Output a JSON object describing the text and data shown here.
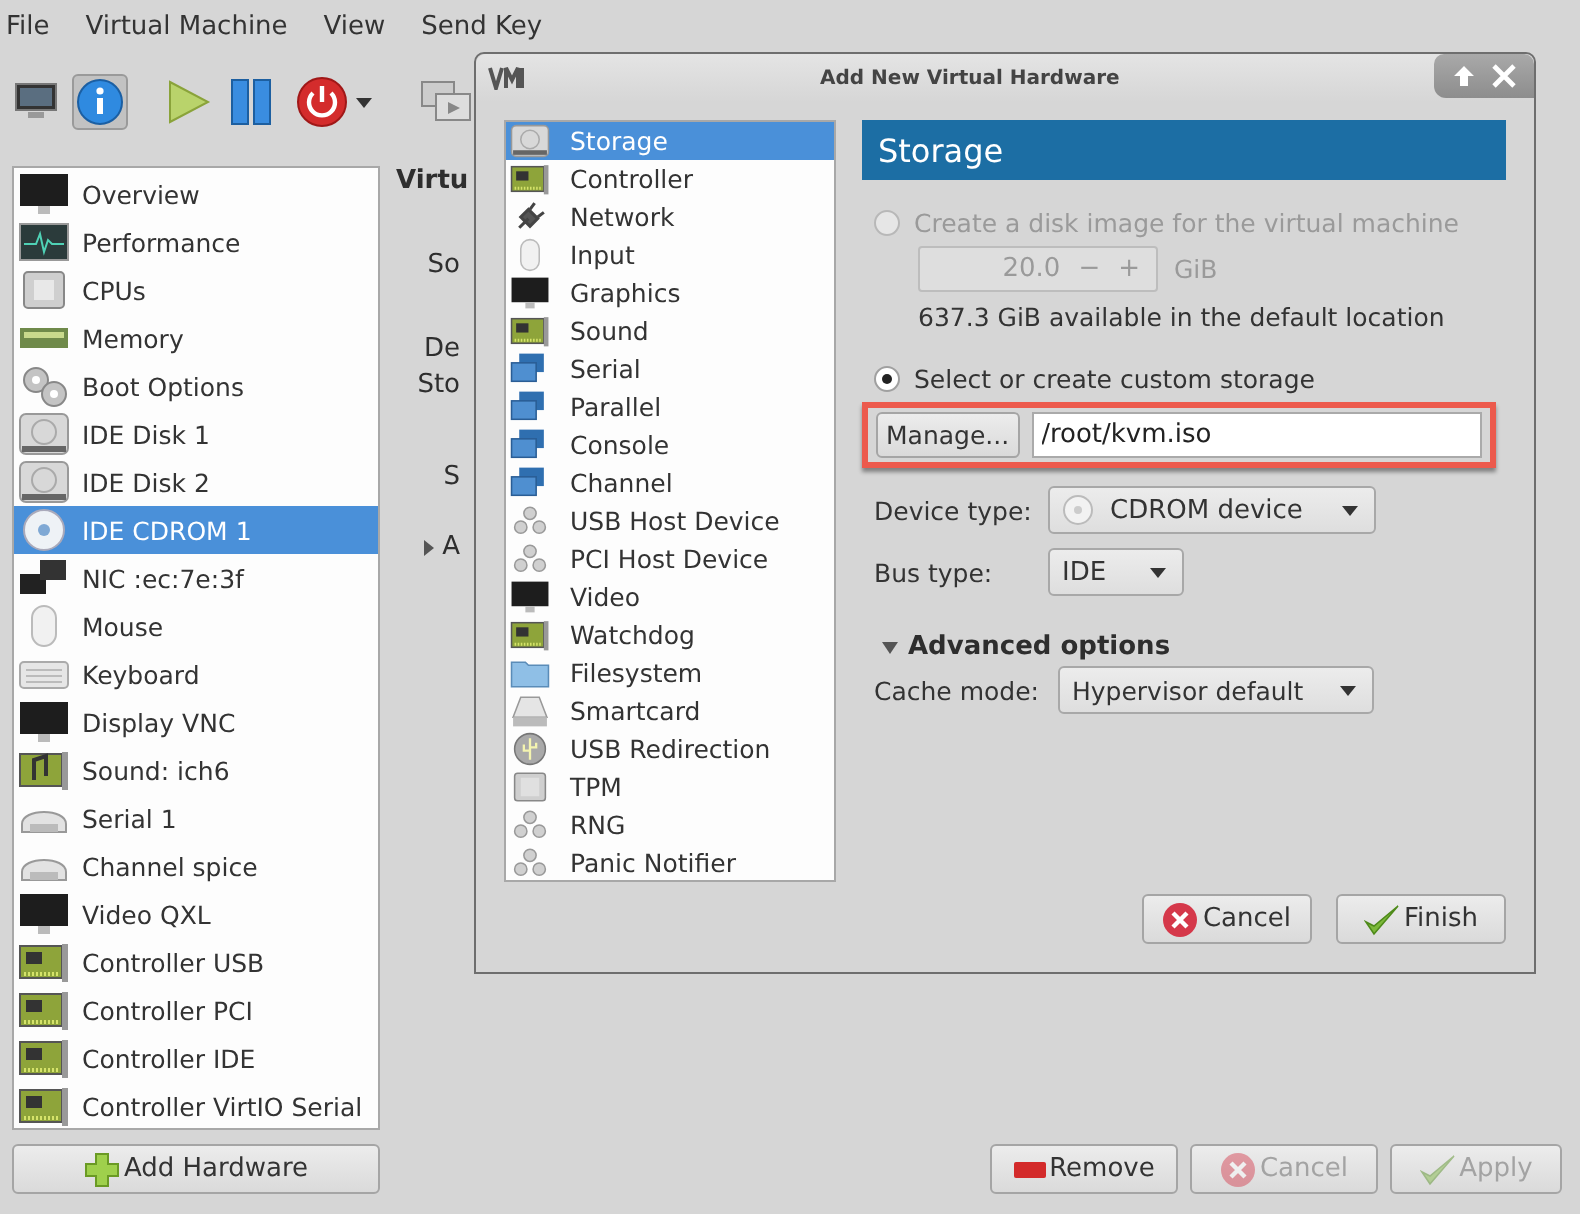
{
  "menu": [
    "File",
    "Virtual Machine",
    "View",
    "Send Key"
  ],
  "toolbar": [
    {
      "selected": false
    },
    {
      "selected": true
    }
  ],
  "hardware_list": [
    {
      "label": "Overview",
      "selected": false
    },
    {
      "label": "Performance",
      "selected": false
    },
    {
      "label": "CPUs",
      "selected": false
    },
    {
      "label": "Memory",
      "selected": false
    },
    {
      "label": "Boot Options",
      "selected": false
    },
    {
      "label": "IDE Disk 1",
      "selected": false
    },
    {
      "label": "IDE Disk 2",
      "selected": false
    },
    {
      "label": "IDE CDROM 1",
      "selected": true
    },
    {
      "label": "NIC :ec:7e:3f",
      "selected": false
    },
    {
      "label": "Mouse",
      "selected": false
    },
    {
      "label": "Keyboard",
      "selected": false
    },
    {
      "label": "Display VNC",
      "selected": false
    },
    {
      "label": "Sound: ich6",
      "selected": false
    },
    {
      "label": "Serial 1",
      "selected": false
    },
    {
      "label": "Channel spice",
      "selected": false
    },
    {
      "label": "Video QXL",
      "selected": false
    },
    {
      "label": "Controller USB",
      "selected": false
    },
    {
      "label": "Controller PCI",
      "selected": false
    },
    {
      "label": "Controller IDE",
      "selected": false
    },
    {
      "label": "Controller VirtIO Serial",
      "selected": false
    }
  ],
  "add_hardware_button": "Add Hardware",
  "details_fragments": [
    "Virtu",
    "So",
    "De",
    "Sto",
    "S",
    "A"
  ],
  "footer_buttons": [
    {
      "label": "Remove",
      "kind": "remove",
      "disabled": false
    },
    {
      "label": "Cancel",
      "kind": "cancel",
      "disabled": true
    },
    {
      "label": "Apply",
      "kind": "apply",
      "disabled": true
    }
  ],
  "dialog": {
    "title": "Add New Virtual Hardware",
    "device_types": [
      {
        "label": "Storage",
        "selected": true
      },
      {
        "label": "Controller",
        "selected": false
      },
      {
        "label": "Network",
        "selected": false
      },
      {
        "label": "Input",
        "selected": false
      },
      {
        "label": "Graphics",
        "selected": false
      },
      {
        "label": "Sound",
        "selected": false
      },
      {
        "label": "Serial",
        "selected": false
      },
      {
        "label": "Parallel",
        "selected": false
      },
      {
        "label": "Console",
        "selected": false
      },
      {
        "label": "Channel",
        "selected": false
      },
      {
        "label": "USB Host Device",
        "selected": false
      },
      {
        "label": "PCI Host Device",
        "selected": false
      },
      {
        "label": "Video",
        "selected": false
      },
      {
        "label": "Watchdog",
        "selected": false
      },
      {
        "label": "Filesystem",
        "selected": false
      },
      {
        "label": "Smartcard",
        "selected": false
      },
      {
        "label": "USB Redirection",
        "selected": false
      },
      {
        "label": "TPM",
        "selected": false
      },
      {
        "label": "RNG",
        "selected": false
      },
      {
        "label": "Panic Notifier",
        "selected": false
      }
    ],
    "header": "Storage",
    "create_disk": {
      "label": "Create a disk image for the virtual machine",
      "selected": false,
      "disabled": true,
      "size": "20.0",
      "minus": "−",
      "plus": "+",
      "unit": "GiB",
      "available": "637.3 GiB available in the default location"
    },
    "custom_storage": {
      "label": "Select or create custom storage",
      "selected": true,
      "disabled": false
    },
    "manage_button": "Manage...",
    "path": "/root/kvm.iso",
    "device_type": {
      "label": "Device type:",
      "value": "CDROM device"
    },
    "bus_type": {
      "label": "Bus type:",
      "value": "IDE"
    },
    "advanced": {
      "label": "Advanced options",
      "expanded": true
    },
    "cache_mode": {
      "label": "Cache mode:",
      "value": "Hypervisor default"
    },
    "buttons": [
      {
        "label": "Cancel",
        "kind": "cancel",
        "disabled": false
      },
      {
        "label": "Finish",
        "kind": "finish",
        "disabled": false
      }
    ]
  }
}
